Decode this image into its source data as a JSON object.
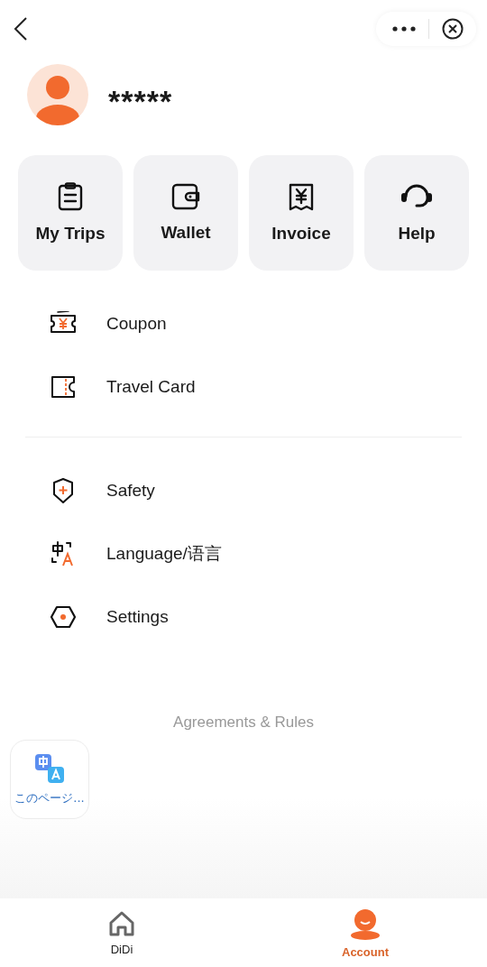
{
  "profile": {
    "name": "*****"
  },
  "shortcuts": [
    {
      "label": "My Trips"
    },
    {
      "label": "Wallet"
    },
    {
      "label": "Invoice"
    },
    {
      "label": "Help"
    }
  ],
  "menu_groups": [
    {
      "items": [
        {
          "label": "Coupon"
        },
        {
          "label": "Travel Card"
        }
      ]
    },
    {
      "items": [
        {
          "label": "Safety"
        },
        {
          "label": "Language/语言"
        },
        {
          "label": "Settings"
        }
      ]
    }
  ],
  "footer_link": "Agreements & Rules",
  "translate_widget": {
    "label": "このページ..."
  },
  "tabs": [
    {
      "label": "DiDi",
      "selected": false
    },
    {
      "label": "Account",
      "selected": true
    }
  ]
}
